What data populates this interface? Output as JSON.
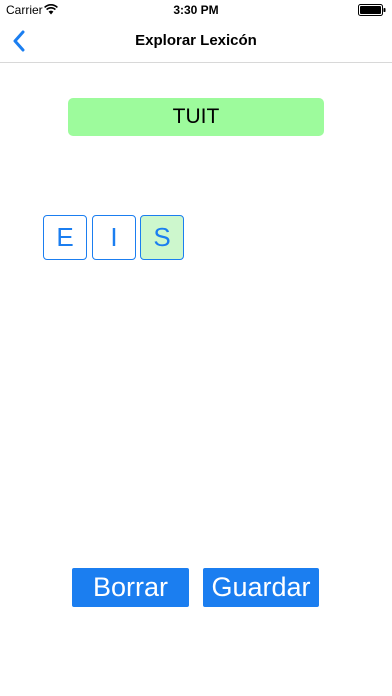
{
  "status_bar": {
    "carrier": "Carrier",
    "time": "3:30 PM"
  },
  "nav": {
    "title": "Explorar Lexicón",
    "back_icon": "chevron-left-icon"
  },
  "word": {
    "text": "TUIT"
  },
  "tiles": [
    {
      "letter": "E",
      "selected": false
    },
    {
      "letter": "I",
      "selected": false
    },
    {
      "letter": "S",
      "selected": true
    }
  ],
  "buttons": {
    "clear_label": "Borrar",
    "save_label": "Guardar"
  },
  "colors": {
    "accent": "#1b7ef0",
    "word_bg": "#9dfb9c",
    "tile_selected_bg": "#cdf7cd"
  }
}
